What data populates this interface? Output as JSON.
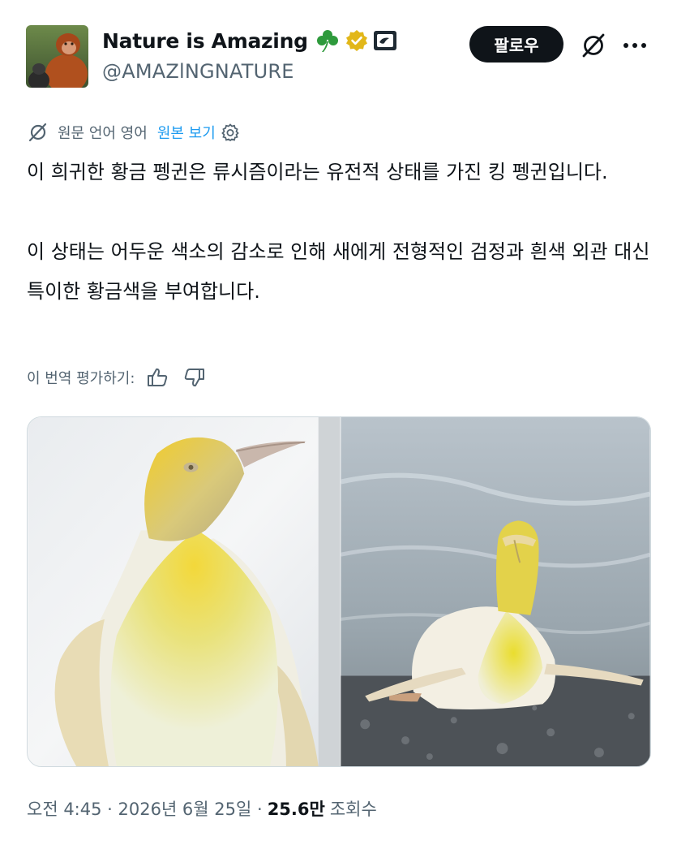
{
  "author": {
    "display_name": "Nature is Amazing",
    "handle": "@AMAZlNGNATURE",
    "avatar_icon": "orangutan-avatar",
    "badges": [
      "shamrock-icon",
      "verified-badge-icon",
      "affiliate-badge-icon"
    ]
  },
  "actions": {
    "follow_label": "팔로우",
    "grok_icon": "grok-icon",
    "more_icon": "more-options-icon"
  },
  "translation": {
    "source_label": "원문 언어 영어",
    "show_original": "원본 보기",
    "rate_label": "이 번역 평가하기:"
  },
  "tweet": {
    "paragraph_1": "이 희귀한 황금 펭귄은 류시즘이라는 유전적 상태를 가진 킹 펭귄입니다.",
    "paragraph_2": "이 상태는 어두운 색소의 감소로 인해 새에게 전형적인 검정과 흰색 외관 대신 특이한 황금색을 부여합니다."
  },
  "media": {
    "images": [
      "golden-penguin-closeup-photo",
      "golden-penguin-on-shore-photo"
    ]
  },
  "meta": {
    "timestamp": "오전 4:45 · 2026년 6월 25일 ·",
    "views_count": "25.6만",
    "views_label": "조회수"
  },
  "colors": {
    "text_primary": "#0f1419",
    "text_secondary": "#536471",
    "link": "#1d9bf0",
    "verified_gold": "#e2b719",
    "shamrock_green": "#2e9a3c"
  }
}
